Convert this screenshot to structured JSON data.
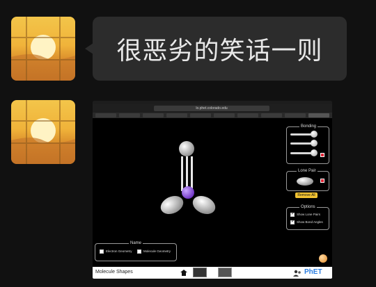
{
  "chat": {
    "message_text": "很恶劣的笑话一则"
  },
  "screenshot": {
    "browser": {
      "url_text": "lo.phet.colorado.edu"
    },
    "sim": {
      "panels": {
        "bonding_title": "Bonding",
        "lone_pair_title": "Lone Pair",
        "remove_all_label": "Remove All",
        "options_title": "Options",
        "show_lone_pairs_label": "Show Lone Pairs",
        "show_bond_angles_label": "Show Bond Angles",
        "name_title": "Name",
        "electron_geometry_label": "Electron Geometry",
        "molecule_geometry_label": "Molecule Geometry"
      },
      "bottom_bar": {
        "title": "Molecule Shapes",
        "logo": "PhET"
      }
    }
  }
}
